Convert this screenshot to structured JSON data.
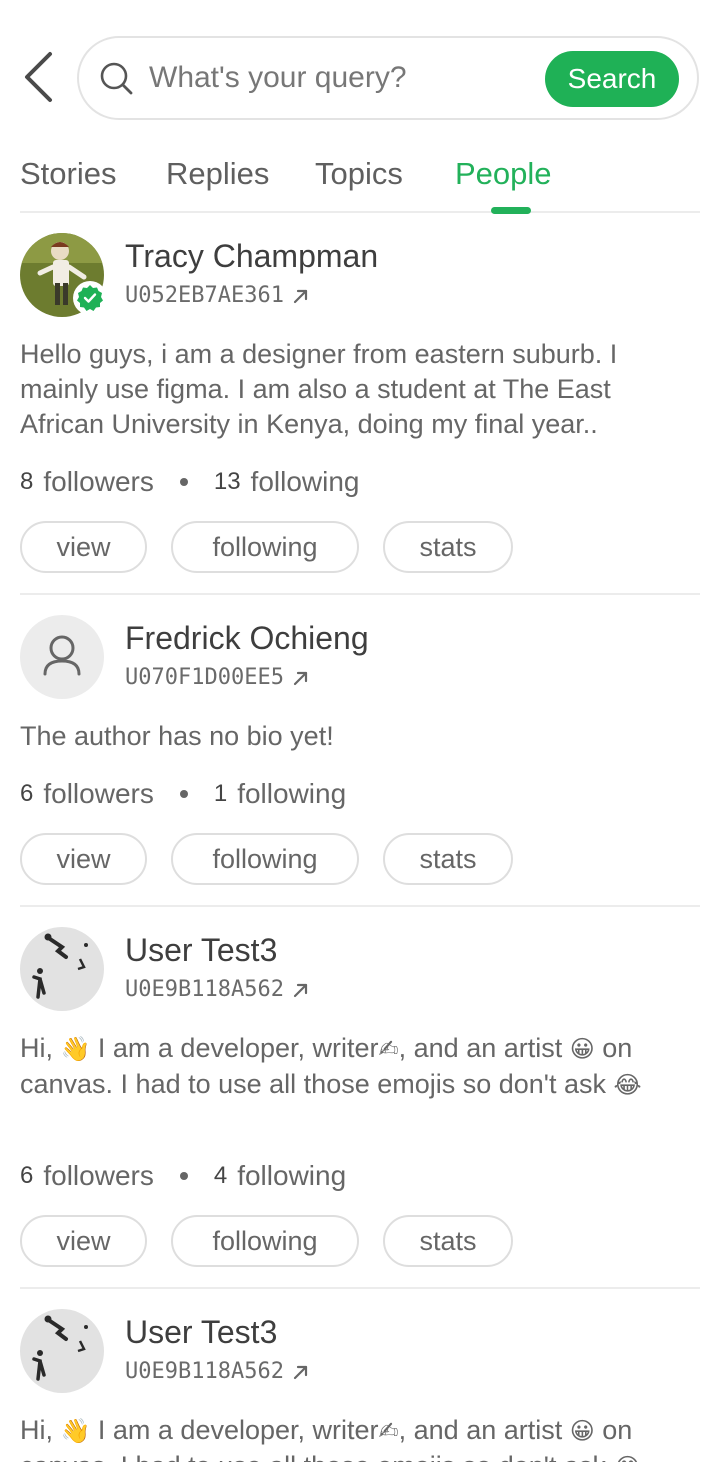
{
  "search": {
    "placeholder": "What's your query?",
    "button_label": "Search"
  },
  "tabs": [
    {
      "label": "Stories"
    },
    {
      "label": "Replies"
    },
    {
      "label": "Topics"
    },
    {
      "label": "People",
      "active": true
    }
  ],
  "colors": {
    "accent": "#1fb156",
    "text": "#4b4b4b",
    "border": "#e3e3e3"
  },
  "people": [
    {
      "name": "Tracy Champman",
      "uid": "U052EB7AE361",
      "verified": true,
      "bio": "Hello guys, i am a designer from eastern suburb. I mainly use figma. I am also a student at The East African University in Kenya, doing my final year..",
      "followers_count": "8",
      "followers_label": "followers",
      "following_count": "13",
      "following_label": "following",
      "actions": {
        "view": "view",
        "following": "following",
        "stats": "stats"
      }
    },
    {
      "name": "Fredrick Ochieng",
      "uid": "U070F1D00EE5",
      "verified": false,
      "bio": "The author has no bio yet!",
      "followers_count": "6",
      "followers_label": "followers",
      "following_count": "1",
      "following_label": "following",
      "actions": {
        "view": "view",
        "following": "following",
        "stats": "stats"
      }
    },
    {
      "name": "User Test3",
      "uid": "U0E9B118A562",
      "verified": false,
      "bio_parts": [
        "Hi, ",
        "👋",
        " I am a developer, writer",
        "✍",
        ", and an artist ",
        "😀",
        " on canvas. I had to use all those emojis so don't ask ",
        "😂"
      ],
      "followers_count": "6",
      "followers_label": "followers",
      "following_count": "4",
      "following_label": "following",
      "actions": {
        "view": "view",
        "following": "following",
        "stats": "stats"
      }
    },
    {
      "name": "User Test3",
      "uid": "U0E9B118A562",
      "verified": false,
      "bio_parts": [
        "Hi, ",
        "👋",
        " I am a developer, writer",
        "✍",
        ", and an artist ",
        "😀",
        " on canvas. I had to use all those emojis so don't ask ",
        "😂"
      ]
    }
  ]
}
